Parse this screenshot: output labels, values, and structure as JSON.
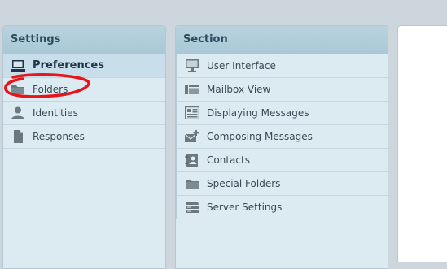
{
  "settings": {
    "header": "Settings",
    "items": [
      {
        "label": "Preferences",
        "icon": "monitor-icon"
      },
      {
        "label": "Folders",
        "icon": "folder-icon"
      },
      {
        "label": "Identities",
        "icon": "person-icon"
      },
      {
        "label": "Responses",
        "icon": "document-icon"
      }
    ],
    "selected_index": 0
  },
  "section": {
    "header": "Section",
    "items": [
      {
        "label": "User Interface",
        "icon": "monitor-icon"
      },
      {
        "label": "Mailbox View",
        "icon": "list-layout-icon"
      },
      {
        "label": "Displaying Messages",
        "icon": "message-display-icon"
      },
      {
        "label": "Composing Messages",
        "icon": "compose-mail-icon"
      },
      {
        "label": "Contacts",
        "icon": "address-book-icon"
      },
      {
        "label": "Special Folders",
        "icon": "folder-icon"
      },
      {
        "label": "Server Settings",
        "icon": "server-icon"
      }
    ]
  },
  "colors": {
    "panel_bg": "#dcebf2",
    "header_bg": "#b0ccd9",
    "selected_bg": "#c8dfeb",
    "annotation_red": "#e8141a",
    "icon_gray": "#6b7880"
  }
}
